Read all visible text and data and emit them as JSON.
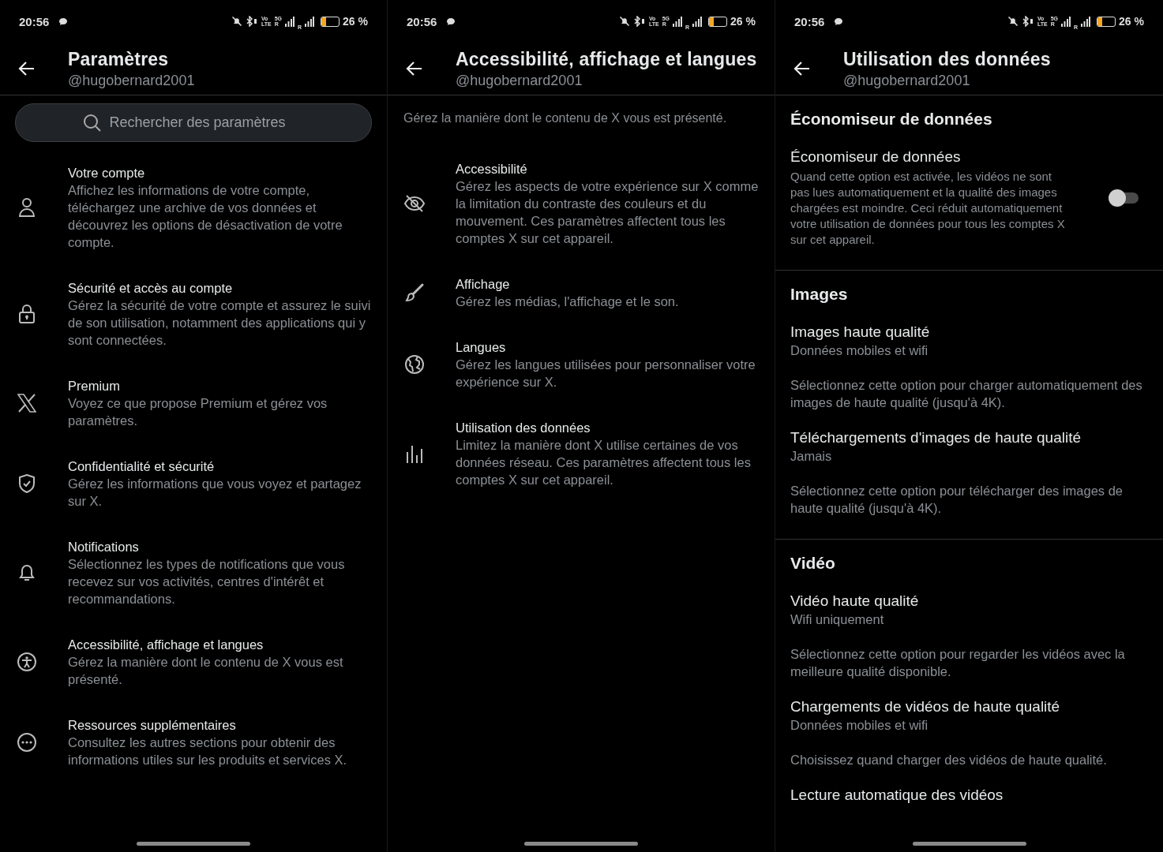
{
  "panels": [
    {
      "status": {
        "time": "20:56",
        "volte_top": "Vo",
        "volte_bottom": "LTE",
        "sim1_tech": "5G",
        "sim1_roaming": "R",
        "sim2_roaming": "R",
        "battery": "26 %"
      },
      "header": {
        "title": "Paramètres",
        "handle": "@hugobernard2001"
      },
      "search": {
        "placeholder": "Rechercher des paramètres"
      },
      "items": [
        {
          "title": "Votre compte",
          "description": "Affichez les informations de votre compte, téléchargez une archive de vos données et découvrez les options de désactivation de votre compte."
        },
        {
          "title": "Sécurité et accès au compte",
          "description": "Gérez la sécurité de votre compte et assurez le suivi de son utilisation, notamment des applications qui y sont connectées."
        },
        {
          "title": "Premium",
          "description": "Voyez ce que propose Premium et gérez vos paramètres."
        },
        {
          "title": "Confidentialité et sécurité",
          "description": "Gérez les informations que vous voyez et partagez sur X."
        },
        {
          "title": "Notifications",
          "description": "Sélectionnez les types de notifications que vous recevez sur vos activités, centres d'intérêt et recommandations."
        },
        {
          "title": "Accessibilité, affichage et langues",
          "description": "Gérez la manière dont le contenu de X vous est présenté."
        },
        {
          "title": "Ressources supplémentaires",
          "description": "Consultez les autres sections pour obtenir des informations utiles sur les produits et services X."
        }
      ]
    },
    {
      "status": {
        "time": "20:56",
        "volte_top": "Vo",
        "volte_bottom": "LTE",
        "sim1_tech": "5G",
        "sim1_roaming": "R",
        "sim2_roaming": "R",
        "battery": "26 %"
      },
      "header": {
        "title": "Accessibilité, affichage et langues",
        "handle": "@hugobernard2001"
      },
      "intro": "Gérez la manière dont le contenu de X vous est présenté.",
      "items": [
        {
          "title": "Accessibilité",
          "description": "Gérez les aspects de votre expérience sur X comme la limitation du contraste des couleurs et du mouvement. Ces paramètres affectent tous les comptes X sur cet appareil."
        },
        {
          "title": "Affichage",
          "description": "Gérez les médias, l'affichage et le son."
        },
        {
          "title": "Langues",
          "description": "Gérez les langues utilisées pour personnaliser votre expérience sur X."
        },
        {
          "title": "Utilisation des données",
          "description": "Limitez la manière dont X utilise certaines de vos données réseau. Ces paramètres affectent tous les comptes X sur cet appareil."
        }
      ]
    },
    {
      "status": {
        "time": "20:56",
        "volte_top": "Vo",
        "volte_bottom": "LTE",
        "sim1_tech": "5G",
        "sim1_roaming": "R",
        "sim2_roaming": "R",
        "battery": "26 %"
      },
      "header": {
        "title": "Utilisation des données",
        "handle": "@hugobernard2001"
      },
      "sections": [
        {
          "heading": "Économiseur de données",
          "rows": [
            {
              "kind": "toggle",
              "title": "Économiseur de données",
              "description": "Quand cette option est activée, les vidéos ne sont pas lues automatiquement et la qualité des images chargées est moindre. Ceci réduit automatiquement votre utilisation de données pour tous les comptes X sur cet appareil.",
              "on": false
            }
          ]
        },
        {
          "heading": "Images",
          "rows": [
            {
              "kind": "option",
              "title": "Images haute qualité",
              "value": "Données mobiles et wifi",
              "description": "Sélectionnez cette option pour charger automatiquement des images de haute qualité (jusqu'à 4K)."
            },
            {
              "kind": "option",
              "title": "Téléchargements d'images de haute qualité",
              "value": "Jamais",
              "description": "Sélectionnez cette option pour télécharger des images de haute qualité (jusqu'à 4K)."
            }
          ]
        },
        {
          "heading": "Vidéo",
          "rows": [
            {
              "kind": "option",
              "title": "Vidéo haute qualité",
              "value": "Wifi uniquement",
              "description": "Sélectionnez cette option pour regarder les vidéos avec la meilleure qualité disponible."
            },
            {
              "kind": "option",
              "title": "Chargements de vidéos de haute qualité",
              "value": "Données mobiles et wifi",
              "description": "Choisissez quand charger des vidéos de haute qualité."
            },
            {
              "kind": "option",
              "title": "Lecture automatique des vidéos"
            }
          ]
        }
      ]
    }
  ]
}
